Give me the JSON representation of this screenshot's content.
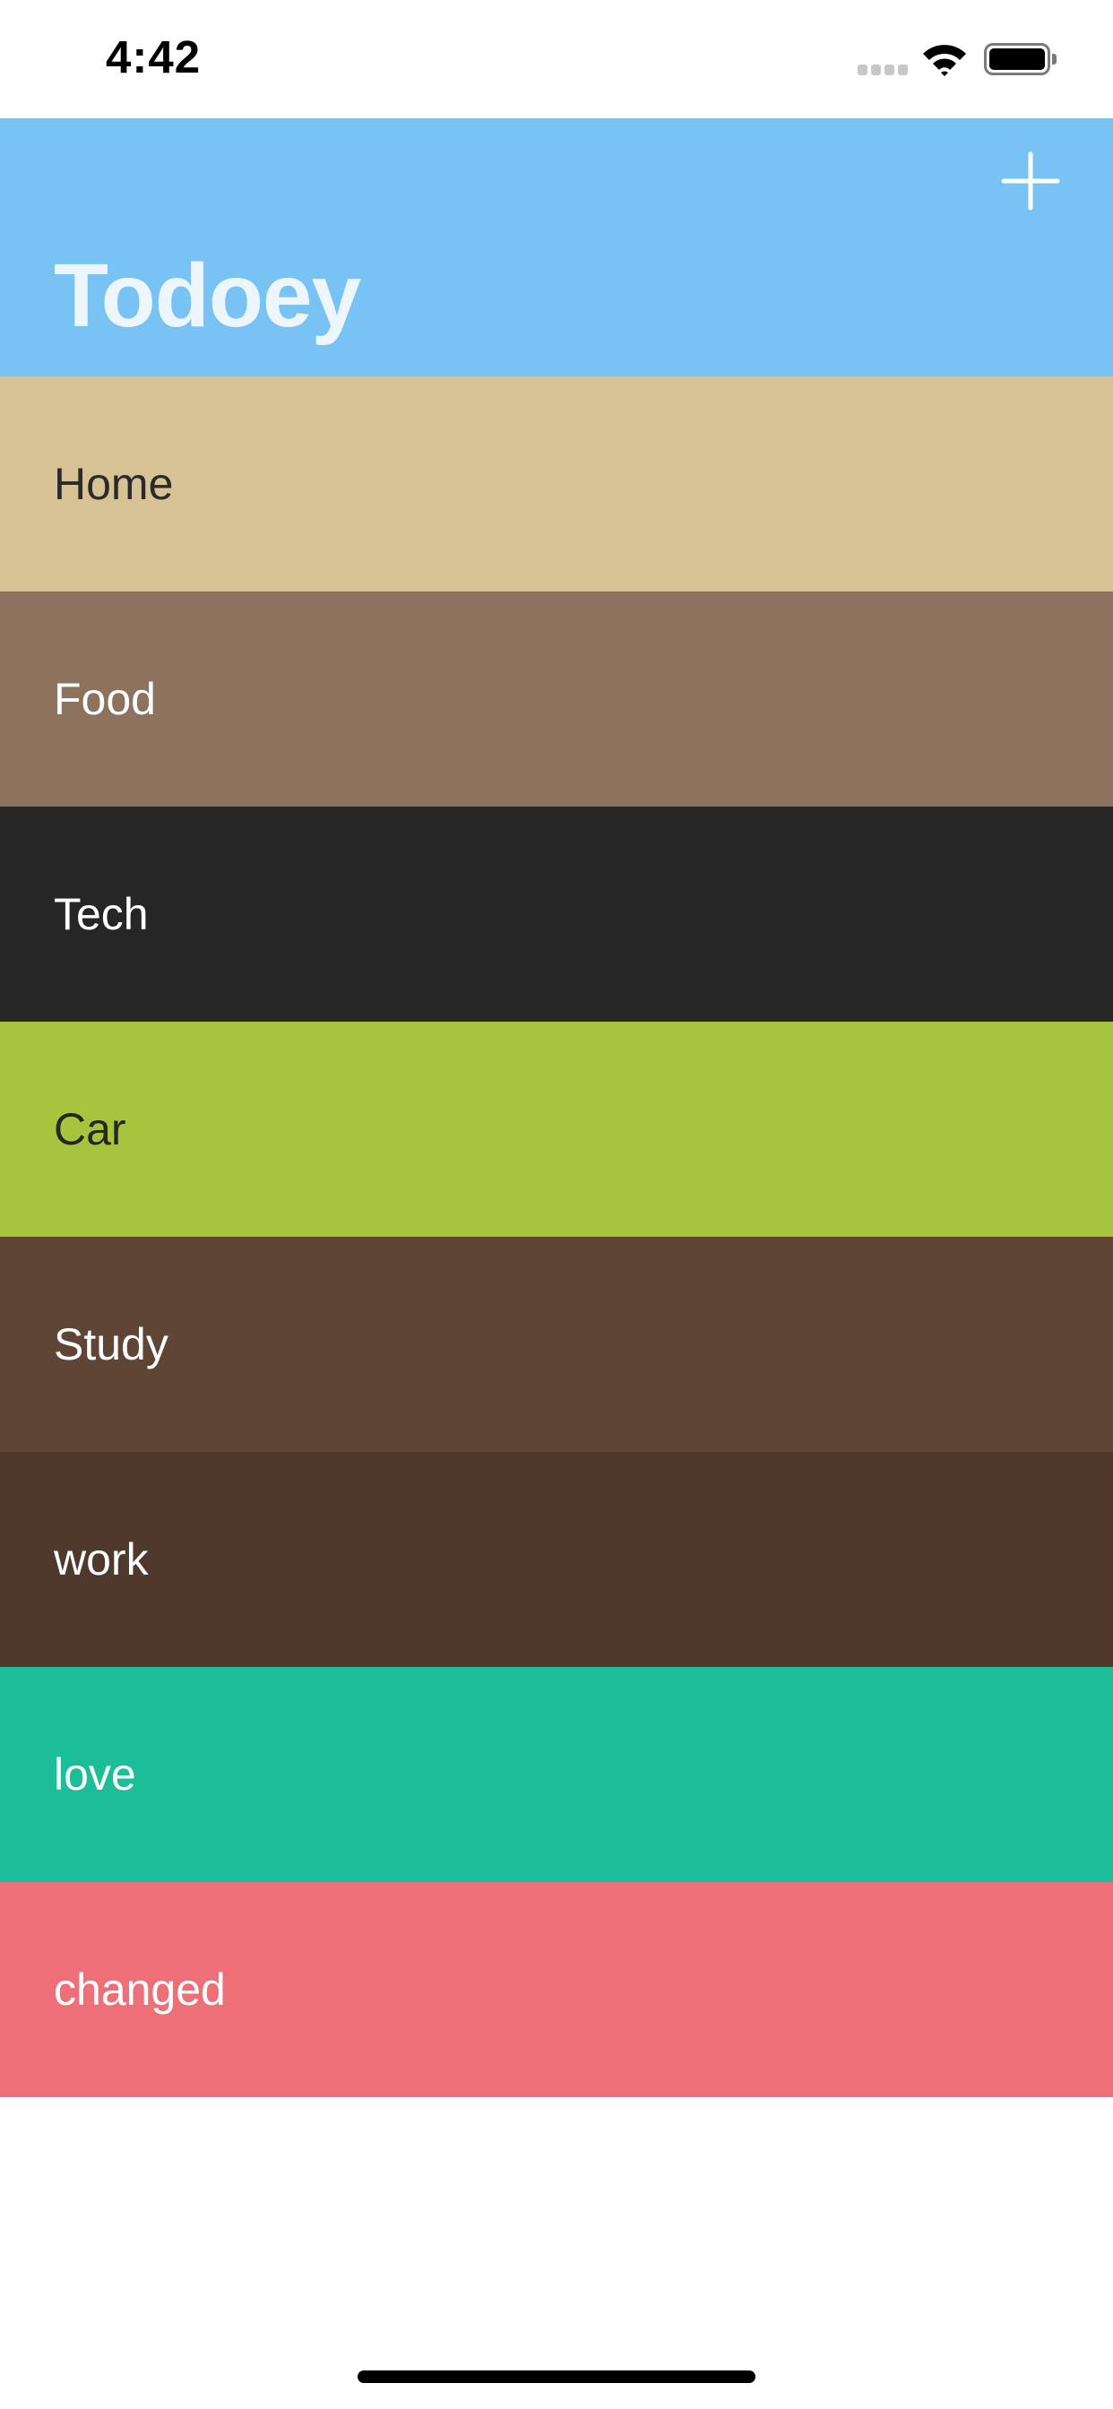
{
  "status_bar": {
    "time": "4:42",
    "battery_level": 1.0
  },
  "nav": {
    "title": "Todoey",
    "background": "#78c3f4",
    "title_color": "#eef6fd",
    "add_icon": "plus-icon"
  },
  "categories": [
    {
      "name": "Home",
      "color": "#d7c295",
      "text_color": "#2a2a2a"
    },
    {
      "name": "Food",
      "color": "#8d725e",
      "text_color": "#ffffff"
    },
    {
      "name": "Tech",
      "color": "#262626",
      "text_color": "#ffffff"
    },
    {
      "name": "Car",
      "color": "#a7c53c",
      "text_color": "#262626"
    },
    {
      "name": "Study",
      "color": "#5e4535",
      "text_color": "#ffffff"
    },
    {
      "name": "work",
      "color": "#4f392d",
      "text_color": "#ffffff"
    },
    {
      "name": "love",
      "color": "#1cbe99",
      "text_color": "#ffffff"
    },
    {
      "name": "changed",
      "color": "#ef6f79",
      "text_color": "#ffffff"
    }
  ]
}
